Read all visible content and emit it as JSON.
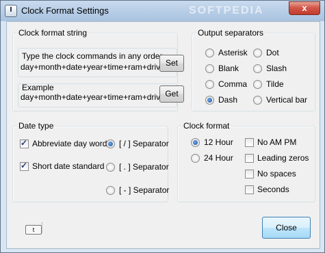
{
  "window": {
    "title": "Clock Format Settings",
    "close_glyph": "x",
    "watermark": "SOFTPEDIA"
  },
  "clock_format_string": {
    "legend": "Clock format string",
    "commands_label": "Type the clock commands in any order",
    "commands_value": "day+month+date+year+time+ram+drive",
    "set_label": "Set",
    "example_label": "Example",
    "example_value": "day+month+date+year+time+ram+drive",
    "get_label": "Get"
  },
  "output_separators": {
    "legend": "Output separators",
    "options": [
      {
        "label": "Asterisk",
        "selected": false
      },
      {
        "label": "Dot",
        "selected": false
      },
      {
        "label": "Blank",
        "selected": false
      },
      {
        "label": "Slash",
        "selected": false
      },
      {
        "label": "Comma",
        "selected": false
      },
      {
        "label": "Tilde",
        "selected": false
      },
      {
        "label": "Dash",
        "selected": true
      },
      {
        "label": "Vertical bar",
        "selected": false
      }
    ]
  },
  "date_type": {
    "legend": "Date type",
    "abbreviate_label": "Abbreviate day word",
    "abbreviate_checked": true,
    "short_date_label": "Short date standard",
    "short_date_checked": true,
    "separators": [
      {
        "label": "[ / ] Separator",
        "selected": true
      },
      {
        "label": "[ . ] Separator",
        "selected": false
      },
      {
        "label": "[ - ] Separator",
        "selected": false
      }
    ]
  },
  "clock_format": {
    "legend": "Clock format",
    "hour12_label": "12 Hour",
    "hour12_selected": true,
    "hour24_label": "24 Hour",
    "hour24_selected": false,
    "checks": [
      {
        "label": "No AM PM",
        "checked": false
      },
      {
        "label": "Leading zeros",
        "checked": false
      },
      {
        "label": "No spaces",
        "checked": false
      },
      {
        "label": "Seconds",
        "checked": false
      }
    ]
  },
  "footer": {
    "keyboard_icon_text": "t",
    "close_label": "Close"
  }
}
